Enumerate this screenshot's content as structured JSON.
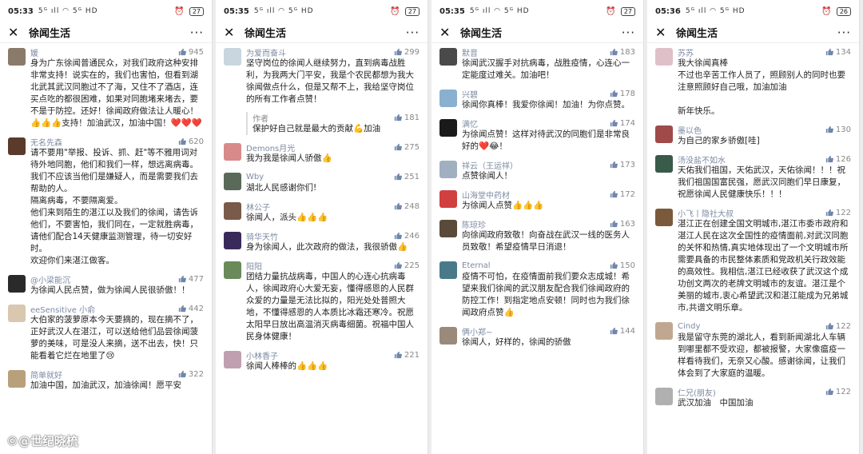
{
  "screens": [
    {
      "status": {
        "time": "05:33",
        "signal": "5ᴳ ıll ◠ 5ᴳ HD",
        "battery": "27"
      },
      "title": "徐闻生活",
      "comments": [
        {
          "nick": "媛",
          "likes": "945",
          "avatar_color": "#8a7a6a",
          "text": "身为广东徐闻普通民众，对我们政府这种安排非常支持！说实在的，我们也害怕，但看到湖北武其武汉同胞过不了海，又住不了酒店，连买点吃的都很困难，如果对同胞堵来堵去，要不是于防控。还好！徐闻政府做法让人暖心！👍👍👍支持！加油武汉，加油中国！❤️❤️❤️"
        },
        {
          "nick": "无名先森",
          "likes": "620",
          "avatar_color": "#5a3a2a",
          "text": "请不要用\"举报、投诉、抓、赶\"等不雅用词对待外地同胞，他们和我们一样，想远离病毒。\n我们不应该当他们是嫌疑人，而是需要我们去帮助的人。\n隔离病毒，不要隔离爱。\n他们来到陌生的湛江以及我们的徐闻，请告诉他们，不要害怕，我们同在，一定就胜病毒，请他们配合14天健康监测管理，待一切安好时。\n欢迎你们来湛江做客。"
        },
        {
          "nick": "@小梁能沉",
          "likes": "477",
          "avatar_color": "#2a2a2a",
          "text": "为徐闻人民点赞，做为徐闻人民很骄傲！！"
        },
        {
          "nick": "eeSensitive 小俞",
          "likes": "442",
          "avatar_color": "#d9c7b0",
          "text": "大伯家的菠萝原本今天要摘的，现在摘不了，正好武汉人在湛江，可以送给他们品尝徐闻菠萝的美味，可是没人来摘，送不出去，快！只能看着它烂在地里了😢"
        },
        {
          "nick": "简单就好",
          "likes": "322",
          "avatar_color": "#b8a07a",
          "text": "加油中国，加油武汉，加油徐闻！愿平安"
        }
      ]
    },
    {
      "status": {
        "time": "05:35",
        "signal": "5ᴳ ıll ◠ 5ᴳ HD",
        "battery": "27"
      },
      "title": "徐闻生活",
      "comments": [
        {
          "nick": "为爱而奋斗",
          "likes": "299",
          "avatar_color": "#c9d6e0",
          "text": "坚守岗位的徐闻人继续努力，直到病毒战胜利，为我两大门平安，我是个农民都想为我大徐闻做点什么，但是又帮不上，我给坚守岗位的所有工作者点赞！",
          "author_reply": {
            "label": "作者",
            "likes": "181",
            "text": "保护好自己就是最大的贡献💪加油"
          }
        },
        {
          "nick": "Demons月光",
          "likes": "275",
          "avatar_color": "#d88a8a",
          "text": "我为我是徐闻人骄傲👍"
        },
        {
          "nick": "Wby",
          "likes": "251",
          "avatar_color": "#5a6a5a",
          "text": "湖北人民感谢你们!"
        },
        {
          "nick": "林公子",
          "likes": "248",
          "avatar_color": "#7a5a4a",
          "text": "徐闻人，派头👍👍👍"
        },
        {
          "nick": "骑华天竹",
          "likes": "246",
          "avatar_color": "#3a2a5a",
          "text": "身为徐闻人，此次政府的做法，我很骄傲👍"
        },
        {
          "nick": "阳阳",
          "likes": "225",
          "avatar_color": "#6a8a5a",
          "text": "团结力量抗战病毒，中国人的心连心抗病毒人，徐闻政府心大爱无妄，懂得感恩的人民群众爱的力量是无法比拟的，阳光处处普照大地，不懂得感恩的人本质比冰霜还寒冷。祝愿太阳早日放出高温消灭病毒细菌。祝福中国人民身体健康！"
        },
        {
          "nick": "小林香子",
          "likes": "221",
          "avatar_color": "#c0a0b0",
          "text": "徐闻人棒棒的👍👍👍"
        }
      ]
    },
    {
      "status": {
        "time": "05:35",
        "signal": "5ᴳ ıll ◠ 5ᴳ HD",
        "battery": "27"
      },
      "title": "徐闻生活",
      "comments": [
        {
          "nick": "默音",
          "likes": "183",
          "avatar_color": "#4a4a4a",
          "text": "徐闻武汉握手对抗病毒，战胜疫情，心连心一定能度过难关。加油吧！"
        },
        {
          "nick": "兴碧",
          "likes": "178",
          "avatar_color": "#8ab0d0",
          "text": "徐闻你真棒！我爱你徐闻！加油！为你点赞。"
        },
        {
          "nick": "满忆",
          "likes": "174",
          "avatar_color": "#1a1a1a",
          "text": "为徐闻点赞！这样对待武汉的同胞们是非常良好的❤️😂！"
        },
        {
          "nick": "祥云（王运祥）",
          "likes": "173",
          "avatar_color": "#a0b0c0",
          "text": "点赞徐闻人！"
        },
        {
          "nick": "山海堂中药材",
          "likes": "172",
          "avatar_color": "#d04040",
          "text": "为徐闻人点赞👍👍👍"
        },
        {
          "nick": "陈琼珍",
          "likes": "163",
          "avatar_color": "#5a4a3a",
          "text": "向徐闻政府致敬！向奋战在武汉一线的医务人员致敬！希望疫情早日消退！"
        },
        {
          "nick": "Eternal",
          "likes": "150",
          "avatar_color": "#4a7a8a",
          "text": "疫情不可怕，在疫情面前我们要众志成城！希望来我们徐闻的武汉朋友配合我们徐闻政府的防控工作！到指定地点安顿！同时也为我们徐闻政府点赞👍"
        },
        {
          "nick": "俩小郑~",
          "likes": "144",
          "avatar_color": "#9a8a7a",
          "text": "徐闻人，好样的，徐闻的骄傲"
        }
      ]
    },
    {
      "status": {
        "time": "05:36",
        "signal": "5ᴳ ıll ◠ 5ᴳ HD",
        "battery": "26"
      },
      "title": "徐闻生活",
      "comments": [
        {
          "nick": "苏苏",
          "likes": "134",
          "avatar_color": "#e0c0c8",
          "text": "我大徐闻真棒\n不过也辛苦工作人员了，照顾别人的同时也要注意照顾好自己哦，加油加油\n\n新年快乐。"
        },
        {
          "nick": "墨以色",
          "likes": "130",
          "avatar_color": "#a04a4a",
          "text": "为自己的家乡骄傲[哇]"
        },
        {
          "nick": "汤没盐不如水",
          "likes": "126",
          "avatar_color": "#3a5a4a",
          "text": "天佑我们祖国，天佑武汉，天佑徐闻！！！祝我们祖国国富民强，愿武汉同胞们早日康复，祝愿徐闻人民健康快乐！！！"
        },
        {
          "nick": "小飞丨隐社大叔",
          "likes": "122",
          "avatar_color": "#7a5a3a",
          "text": "湛江正在创建全国文明城市,湛江市委市政府和湛江人民在这次全国性的疫情面前,对武汉同胞的关怀和热情,真实地体现出了一个文明城市所需要具备的市民整体素质和党政机关行政效能的高效性。我相信,湛江已经收获了武汉这个成功创文两次的老牌文明城市的友谊。湛江是个美丽的城市,衷心希望武汉和湛江能成为兄弟城市,共谱文明乐章。"
        },
        {
          "nick": "Cindy",
          "likes": "122",
          "avatar_color": "#c0a890",
          "text": "我是留守东莞的湖北人，看到新闻湖北人车辆到哪里都不受欢迎，都被报警，大家像瘟疫一样看待我们，无奈又心酸。感谢徐闻，让我们体会到了大家庭的温暖。"
        },
        {
          "nick": "仁兄(朋友)",
          "likes": "122",
          "avatar_color": "#b0b0b0",
          "text": "武汉加油　中国加油"
        }
      ]
    }
  ],
  "watermark": "©@世纪晓梳"
}
